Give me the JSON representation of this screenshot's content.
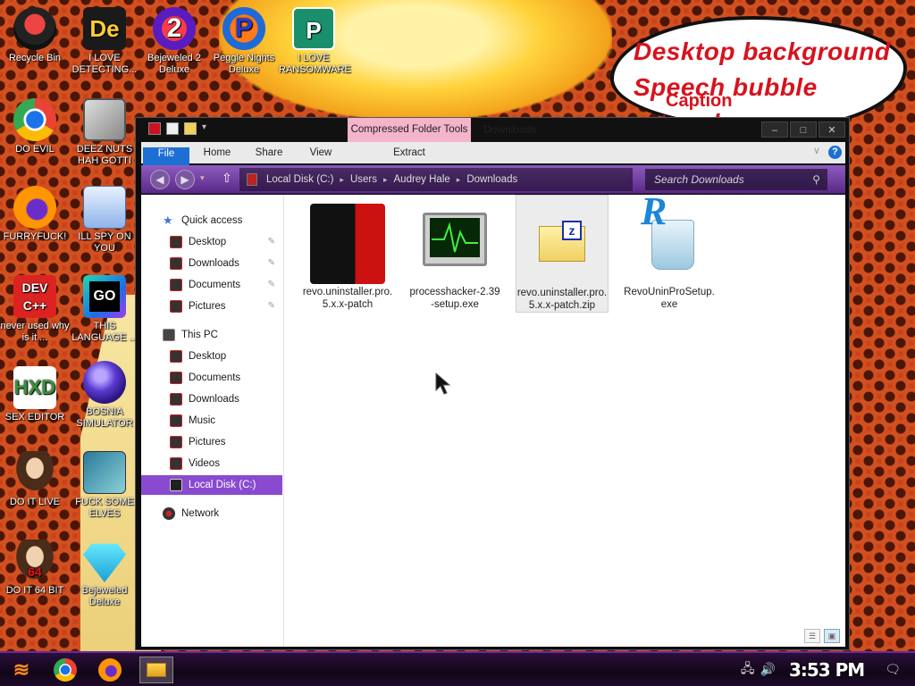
{
  "wallpaper": {
    "bubble": [
      "Desktop background",
      "Speech bubble artwork",
      "Caption"
    ]
  },
  "desktop_icons": [
    {
      "label": "Recycle Bin"
    },
    {
      "label": "I LOVE DETECTING..."
    },
    {
      "label": "Bejeweled 2 Deluxe"
    },
    {
      "label": "Peggle Nights Deluxe"
    },
    {
      "label": "I LOVE RANSOMWARE"
    },
    {
      "label": "DO EVIL"
    },
    {
      "label": "DEEZ NUTS HAH GOTTI"
    },
    {
      "label": "FURRYFUCK!"
    },
    {
      "label": "ILL SPY ON YOU"
    },
    {
      "label": "never used why is it ..."
    },
    {
      "label": "THIS LANGUAGE ..."
    },
    {
      "label": "SEX EDITOR"
    },
    {
      "label": "BOSNIA SIMULATOR"
    },
    {
      "label": "DO IT LIVE"
    },
    {
      "label": "FUCK SOME ELVES"
    },
    {
      "label": "DO IT 64 BIT"
    },
    {
      "label": "Bejeweled Deluxe"
    }
  ],
  "explorer": {
    "context_tab": "Compressed Folder Tools",
    "title": "Downloads",
    "window_buttons": [
      "–",
      "□",
      "✕"
    ],
    "ribbon_tabs": [
      "File",
      "Home",
      "Share",
      "View",
      "Extract"
    ],
    "help": "?",
    "breadcrumb": [
      "Local Disk (C:)",
      "Users",
      "Audrey Hale",
      "Downloads"
    ],
    "search_placeholder": "Search Downloads",
    "nav": {
      "quick_access": "Quick access",
      "quick_items": [
        "Desktop",
        "Downloads",
        "Documents",
        "Pictures"
      ],
      "this_pc": "This PC",
      "pc_items": [
        "Desktop",
        "Documents",
        "Downloads",
        "Music",
        "Pictures",
        "Videos",
        "Local Disk (C:)"
      ],
      "network": "Network"
    },
    "files": [
      {
        "name": "revo.uninstaller.pro.5.x.x-patch",
        "icon": "revo-folder-icon"
      },
      {
        "name": "processhacker-2.39-setup.exe",
        "icon": "process-hacker-icon"
      },
      {
        "name": "revo.uninstaller.pro.5.x.x-patch.zip",
        "icon": "zip-folder-icon",
        "selected": true
      },
      {
        "name": "RevoUninProSetup.exe",
        "icon": "revo-setup-icon"
      }
    ]
  },
  "taskbar": {
    "clock": "3:53 PM"
  }
}
